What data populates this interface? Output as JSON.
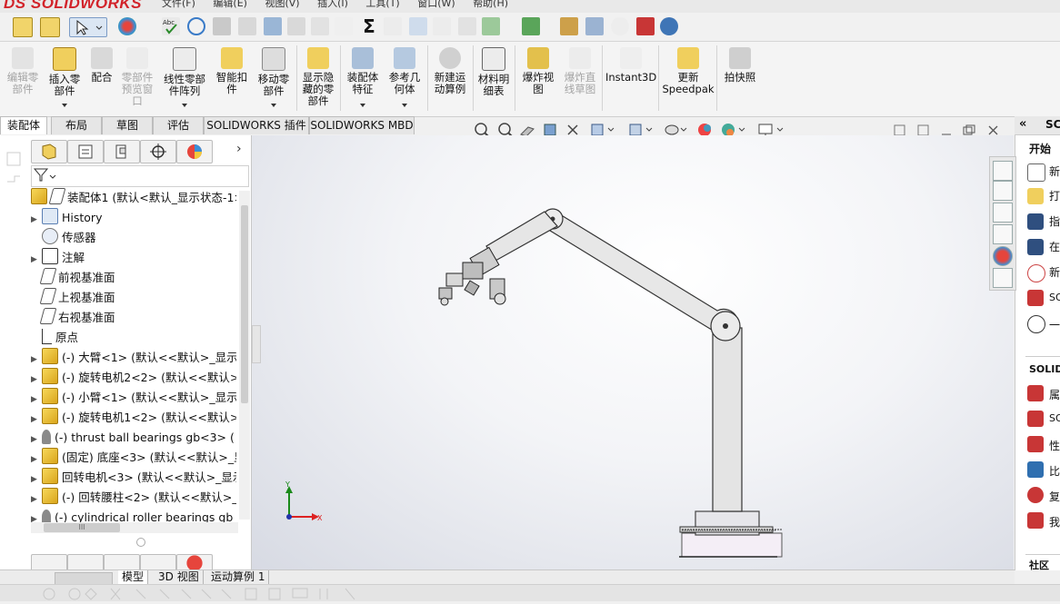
{
  "app": {
    "logo": "SOLIDWORKS",
    "logo_prefix": "DS"
  },
  "menu": [
    "文件(F)",
    "编辑(E)",
    "视图(V)",
    "插入(I)",
    "工具(T)",
    "窗口(W)",
    "帮助(H)"
  ],
  "command_manager": {
    "buttons": [
      {
        "label": "编辑零\n部件",
        "enabled": false,
        "icon": "edit-component-icon"
      },
      {
        "label": "插入零\n部件",
        "enabled": true,
        "icon": "insert-components-icon"
      },
      {
        "label": "配合",
        "enabled": true,
        "icon": "mate-icon"
      },
      {
        "label": "零部件\n预览窗\n口",
        "enabled": false,
        "icon": "component-preview-icon"
      },
      {
        "label": "线性零部\n件阵列",
        "enabled": true,
        "icon": "linear-pattern-icon"
      },
      {
        "label": "智能扣\n件",
        "enabled": true,
        "icon": "smart-fasteners-icon"
      },
      {
        "label": "移动零\n部件",
        "enabled": true,
        "icon": "move-component-icon"
      },
      {
        "label": "显示隐\n藏的零\n部件",
        "enabled": true,
        "icon": "show-hidden-icon"
      },
      {
        "label": "装配体\n特征",
        "enabled": true,
        "icon": "assembly-features-icon"
      },
      {
        "label": "参考几\n何体",
        "enabled": true,
        "icon": "reference-geometry-icon"
      },
      {
        "label": "新建运\n动算例",
        "enabled": true,
        "icon": "new-motion-study-icon"
      },
      {
        "label": "材料明\n细表",
        "enabled": true,
        "icon": "bill-of-materials-icon"
      },
      {
        "label": "爆炸视\n图",
        "enabled": true,
        "icon": "exploded-view-icon"
      },
      {
        "label": "爆炸直\n线草图",
        "enabled": false,
        "icon": "explode-line-sketch-icon"
      },
      {
        "label": "Instant3D",
        "enabled": true,
        "icon": "instant3d-icon"
      },
      {
        "label": "更新\nSpeedpak",
        "enabled": true,
        "icon": "speedpak-icon"
      },
      {
        "label": "拍快照",
        "enabled": true,
        "icon": "snapshot-icon"
      }
    ]
  },
  "tabs": [
    "装配体",
    "布局",
    "草图",
    "评估",
    "SOLIDWORKS 插件",
    "SOLIDWORKS MBD"
  ],
  "active_tab": "装配体",
  "tree": {
    "root": "装配体1 (默认<默认_显示状态-1>",
    "items": [
      {
        "label": "History",
        "icon": "history-folder-icon",
        "expandable": true
      },
      {
        "label": "传感器",
        "icon": "sensors-icon",
        "expandable": false
      },
      {
        "label": "注解",
        "icon": "annotations-icon",
        "expandable": true
      },
      {
        "label": "前视基准面",
        "icon": "plane-icon",
        "expandable": false
      },
      {
        "label": "上视基准面",
        "icon": "plane-icon",
        "expandable": false
      },
      {
        "label": "右视基准面",
        "icon": "plane-icon",
        "expandable": false
      },
      {
        "label": "原点",
        "icon": "origin-icon",
        "expandable": false
      },
      {
        "label": "(-) 大臂<1> (默认<<默认>_显示状",
        "icon": "subassembly-icon",
        "expandable": true
      },
      {
        "label": "(-) 旋转电机2<2> (默认<<默认>_",
        "icon": "subassembly-icon",
        "expandable": true
      },
      {
        "label": "(-) 小臂<1> (默认<<默认>_显示状",
        "icon": "subassembly-icon",
        "expandable": true
      },
      {
        "label": "(-) 旋转电机1<2> (默认<<默认>_",
        "icon": "subassembly-icon",
        "expandable": true
      },
      {
        "label": "(-) thrust ball bearings gb<3> (",
        "icon": "part-icon",
        "expandable": true
      },
      {
        "label": "(固定) 底座<3> (默认<<默认>_显",
        "icon": "subassembly-icon",
        "expandable": true
      },
      {
        "label": "回转电机<3> (默认<<默认>_显示",
        "icon": "subassembly-icon",
        "expandable": true
      },
      {
        "label": "(-) 回转腰柱<2> (默认<<默认>_显",
        "icon": "subassembly-icon",
        "expandable": true
      },
      {
        "label": "(-) cylindrical roller bearings gb",
        "icon": "part-icon",
        "expandable": true
      }
    ],
    "hscroll_label": "III"
  },
  "bottom_tabs": [
    "模型",
    "3D 视图",
    "运动算例 1"
  ],
  "active_bottom_tab": "模型",
  "task_pane": {
    "header": "SC",
    "section1": "开始",
    "items1": [
      "新",
      "打",
      "指",
      "在",
      "新",
      "SO",
      "一"
    ],
    "section2": "SOLIDW",
    "items2": [
      "属",
      "SO",
      "性",
      "比",
      "复",
      "我"
    ],
    "section3": "社区"
  },
  "triad": {
    "x_label": "X",
    "y_label": "Y"
  },
  "colors": {
    "accent_red": "#d2232a",
    "graphics_bg": "#e8eaf0",
    "arm": "#ececec"
  }
}
